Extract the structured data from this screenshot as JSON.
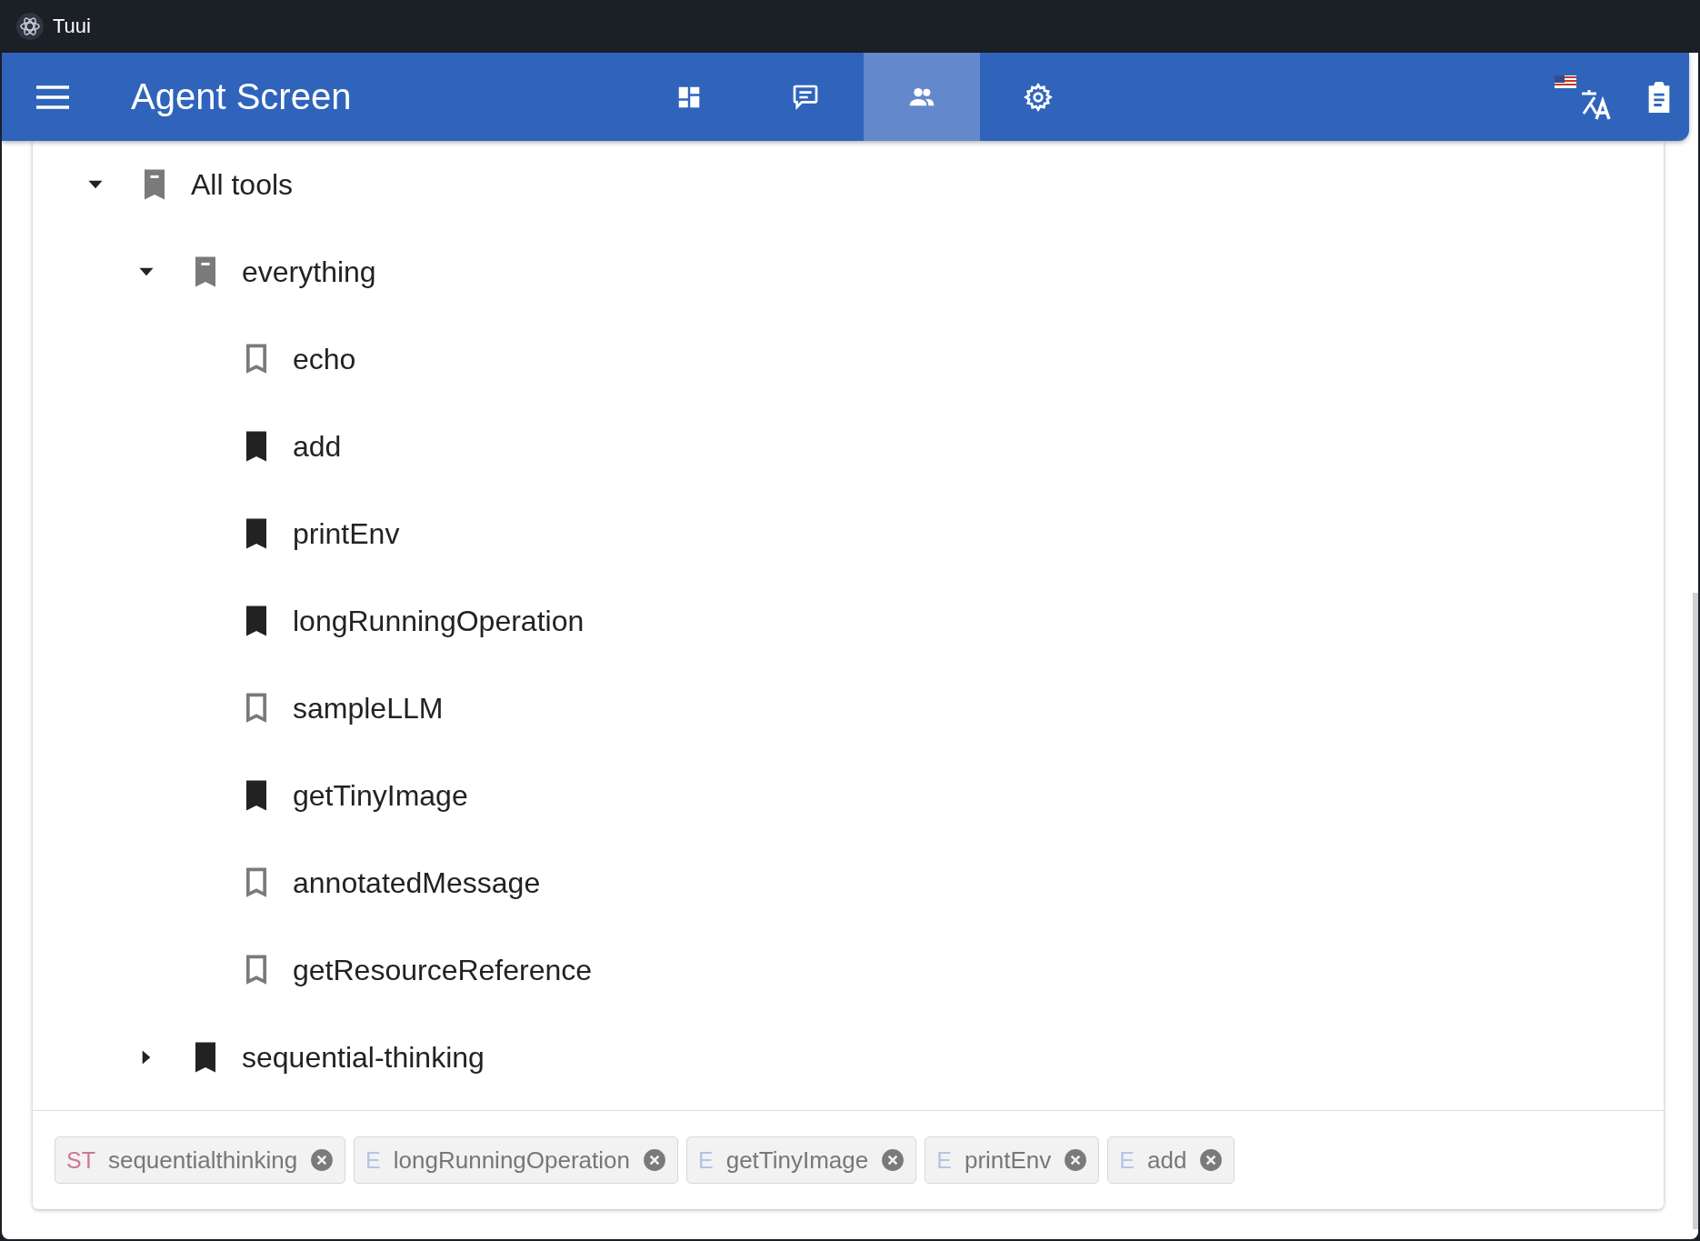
{
  "window": {
    "title": "Tuui"
  },
  "app_bar": {
    "title": "Agent Screen",
    "tabs": [
      {
        "kind": "dashboard",
        "selected": false
      },
      {
        "kind": "chat",
        "selected": false
      },
      {
        "kind": "agents",
        "selected": true
      },
      {
        "kind": "settings",
        "selected": false
      }
    ]
  },
  "tree": [
    {
      "label": "All tools",
      "checked": false,
      "indeterminate": true,
      "expanded": true,
      "children": [
        {
          "label": "everything",
          "checked": false,
          "indeterminate": true,
          "expanded": true,
          "children": [
            {
              "label": "echo",
              "checked": false,
              "indeterminate": false
            },
            {
              "label": "add",
              "checked": true,
              "indeterminate": false
            },
            {
              "label": "printEnv",
              "checked": true,
              "indeterminate": false
            },
            {
              "label": "longRunningOperation",
              "checked": true,
              "indeterminate": false
            },
            {
              "label": "sampleLLM",
              "checked": false,
              "indeterminate": false
            },
            {
              "label": "getTinyImage",
              "checked": true,
              "indeterminate": false
            },
            {
              "label": "annotatedMessage",
              "checked": false,
              "indeterminate": false
            },
            {
              "label": "getResourceReference",
              "checked": false,
              "indeterminate": false
            }
          ]
        },
        {
          "label": "sequential-thinking",
          "checked": true,
          "indeterminate": false,
          "expanded": false
        }
      ]
    }
  ],
  "chips": [
    {
      "prefix": "ST",
      "color": "#c97a90",
      "label": "sequentialthinking"
    },
    {
      "prefix": "E",
      "color": "#b4c4e8",
      "label": "longRunningOperation"
    },
    {
      "prefix": "E",
      "color": "#b4c4e8",
      "label": "getTinyImage"
    },
    {
      "prefix": "E",
      "color": "#b4c4e8",
      "label": "printEnv"
    },
    {
      "prefix": "E",
      "color": "#b4c4e8",
      "label": "add"
    }
  ]
}
